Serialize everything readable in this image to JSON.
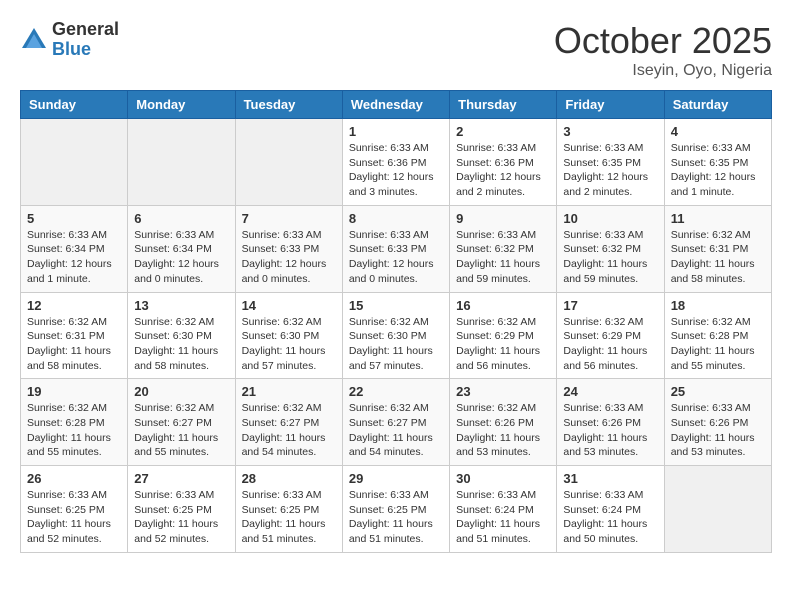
{
  "logo": {
    "general": "General",
    "blue": "Blue"
  },
  "header": {
    "month": "October 2025",
    "location": "Iseyin, Oyo, Nigeria"
  },
  "weekdays": [
    "Sunday",
    "Monday",
    "Tuesday",
    "Wednesday",
    "Thursday",
    "Friday",
    "Saturday"
  ],
  "weeks": [
    [
      {
        "day": "",
        "info": ""
      },
      {
        "day": "",
        "info": ""
      },
      {
        "day": "",
        "info": ""
      },
      {
        "day": "1",
        "info": "Sunrise: 6:33 AM\nSunset: 6:36 PM\nDaylight: 12 hours\nand 3 minutes."
      },
      {
        "day": "2",
        "info": "Sunrise: 6:33 AM\nSunset: 6:36 PM\nDaylight: 12 hours\nand 2 minutes."
      },
      {
        "day": "3",
        "info": "Sunrise: 6:33 AM\nSunset: 6:35 PM\nDaylight: 12 hours\nand 2 minutes."
      },
      {
        "day": "4",
        "info": "Sunrise: 6:33 AM\nSunset: 6:35 PM\nDaylight: 12 hours\nand 1 minute."
      }
    ],
    [
      {
        "day": "5",
        "info": "Sunrise: 6:33 AM\nSunset: 6:34 PM\nDaylight: 12 hours\nand 1 minute."
      },
      {
        "day": "6",
        "info": "Sunrise: 6:33 AM\nSunset: 6:34 PM\nDaylight: 12 hours\nand 0 minutes."
      },
      {
        "day": "7",
        "info": "Sunrise: 6:33 AM\nSunset: 6:33 PM\nDaylight: 12 hours\nand 0 minutes."
      },
      {
        "day": "8",
        "info": "Sunrise: 6:33 AM\nSunset: 6:33 PM\nDaylight: 12 hours\nand 0 minutes."
      },
      {
        "day": "9",
        "info": "Sunrise: 6:33 AM\nSunset: 6:32 PM\nDaylight: 11 hours\nand 59 minutes."
      },
      {
        "day": "10",
        "info": "Sunrise: 6:33 AM\nSunset: 6:32 PM\nDaylight: 11 hours\nand 59 minutes."
      },
      {
        "day": "11",
        "info": "Sunrise: 6:32 AM\nSunset: 6:31 PM\nDaylight: 11 hours\nand 58 minutes."
      }
    ],
    [
      {
        "day": "12",
        "info": "Sunrise: 6:32 AM\nSunset: 6:31 PM\nDaylight: 11 hours\nand 58 minutes."
      },
      {
        "day": "13",
        "info": "Sunrise: 6:32 AM\nSunset: 6:30 PM\nDaylight: 11 hours\nand 58 minutes."
      },
      {
        "day": "14",
        "info": "Sunrise: 6:32 AM\nSunset: 6:30 PM\nDaylight: 11 hours\nand 57 minutes."
      },
      {
        "day": "15",
        "info": "Sunrise: 6:32 AM\nSunset: 6:30 PM\nDaylight: 11 hours\nand 57 minutes."
      },
      {
        "day": "16",
        "info": "Sunrise: 6:32 AM\nSunset: 6:29 PM\nDaylight: 11 hours\nand 56 minutes."
      },
      {
        "day": "17",
        "info": "Sunrise: 6:32 AM\nSunset: 6:29 PM\nDaylight: 11 hours\nand 56 minutes."
      },
      {
        "day": "18",
        "info": "Sunrise: 6:32 AM\nSunset: 6:28 PM\nDaylight: 11 hours\nand 55 minutes."
      }
    ],
    [
      {
        "day": "19",
        "info": "Sunrise: 6:32 AM\nSunset: 6:28 PM\nDaylight: 11 hours\nand 55 minutes."
      },
      {
        "day": "20",
        "info": "Sunrise: 6:32 AM\nSunset: 6:27 PM\nDaylight: 11 hours\nand 55 minutes."
      },
      {
        "day": "21",
        "info": "Sunrise: 6:32 AM\nSunset: 6:27 PM\nDaylight: 11 hours\nand 54 minutes."
      },
      {
        "day": "22",
        "info": "Sunrise: 6:32 AM\nSunset: 6:27 PM\nDaylight: 11 hours\nand 54 minutes."
      },
      {
        "day": "23",
        "info": "Sunrise: 6:32 AM\nSunset: 6:26 PM\nDaylight: 11 hours\nand 53 minutes."
      },
      {
        "day": "24",
        "info": "Sunrise: 6:33 AM\nSunset: 6:26 PM\nDaylight: 11 hours\nand 53 minutes."
      },
      {
        "day": "25",
        "info": "Sunrise: 6:33 AM\nSunset: 6:26 PM\nDaylight: 11 hours\nand 53 minutes."
      }
    ],
    [
      {
        "day": "26",
        "info": "Sunrise: 6:33 AM\nSunset: 6:25 PM\nDaylight: 11 hours\nand 52 minutes."
      },
      {
        "day": "27",
        "info": "Sunrise: 6:33 AM\nSunset: 6:25 PM\nDaylight: 11 hours\nand 52 minutes."
      },
      {
        "day": "28",
        "info": "Sunrise: 6:33 AM\nSunset: 6:25 PM\nDaylight: 11 hours\nand 51 minutes."
      },
      {
        "day": "29",
        "info": "Sunrise: 6:33 AM\nSunset: 6:25 PM\nDaylight: 11 hours\nand 51 minutes."
      },
      {
        "day": "30",
        "info": "Sunrise: 6:33 AM\nSunset: 6:24 PM\nDaylight: 11 hours\nand 51 minutes."
      },
      {
        "day": "31",
        "info": "Sunrise: 6:33 AM\nSunset: 6:24 PM\nDaylight: 11 hours\nand 50 minutes."
      },
      {
        "day": "",
        "info": ""
      }
    ]
  ]
}
